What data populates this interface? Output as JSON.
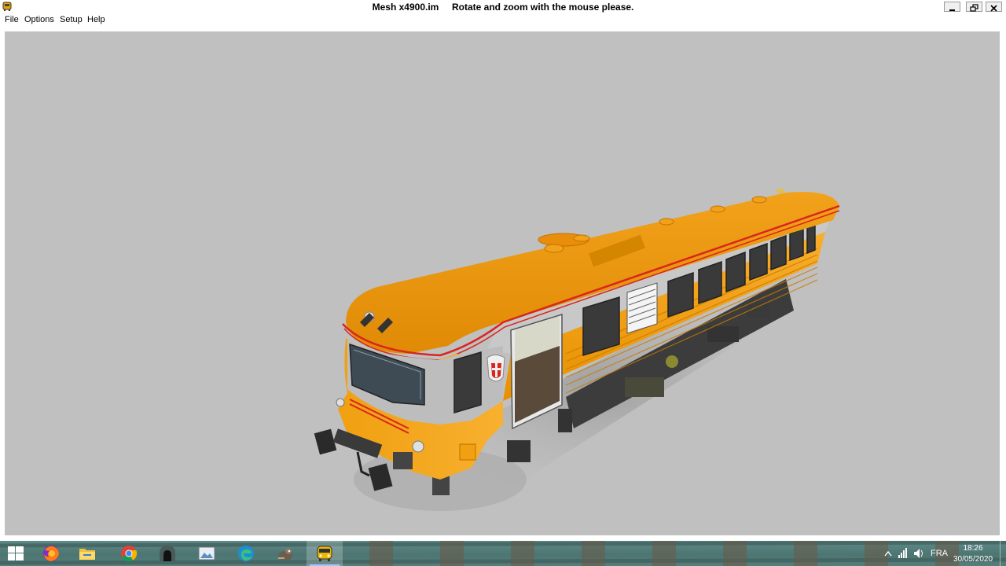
{
  "window": {
    "filename": "Mesh x4900.im",
    "instruction": "Rotate and zoom with the mouse please."
  },
  "menu": {
    "items": [
      "File",
      "Options",
      "Setup",
      "Help"
    ]
  },
  "taskbar": {
    "apps": [
      {
        "name": "firefox-icon"
      },
      {
        "name": "file-explorer-icon"
      },
      {
        "name": "chrome-icon"
      },
      {
        "name": "tunnel-app-icon"
      },
      {
        "name": "image-viewer-icon"
      },
      {
        "name": "edge-icon"
      },
      {
        "name": "gimp-icon"
      },
      {
        "name": "train-viewer-icon"
      }
    ],
    "tray": {
      "language": "FRA",
      "time": "18:26",
      "date": "30/05/2020"
    }
  },
  "colors": {
    "viewport_bg": "#c0c0c0",
    "train_body": "#f5a300",
    "train_roof": "#e88e0a",
    "train_band": "#c6c6c6",
    "stripe_red": "#d9261c"
  }
}
